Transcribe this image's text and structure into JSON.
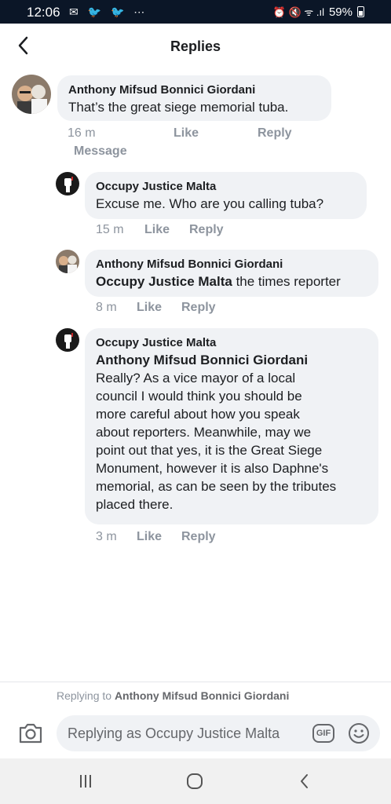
{
  "status_bar": {
    "time": "12:06",
    "notification_icons": "✉ 🐦 🐦 ⋯",
    "system_icons": "⏰ 🔇 ᯤ .ıl",
    "battery": "59%"
  },
  "header": {
    "title": "Replies"
  },
  "comments": [
    {
      "author": "Anthony Mifsud Bonnici Giordani",
      "text": "That’s the great siege memorial tuba.",
      "time": "16 m",
      "like": "Like",
      "reply": "Reply",
      "message": "Message"
    },
    {
      "author": "Occupy Justice Malta",
      "text": "Excuse me.  Who are you calling tuba?",
      "time": "15 m",
      "like": "Like",
      "reply": "Reply"
    },
    {
      "author": "Anthony Mifsud Bonnici Giordani",
      "tag": "Occupy Justice Malta",
      "text": " the times reporter",
      "time": "8 m",
      "like": "Like",
      "reply": "Reply"
    },
    {
      "author": "Occupy Justice Malta",
      "tag": "Anthony Mifsud Bonnici Giordani",
      "text_lines": [
        "Really?  As a vice mayor of a local",
        "council I would think you should be",
        "more careful about how you speak",
        "about reporters.  Meanwhile, may we",
        "point out that yes, it is the Great Siege",
        "Monument, however it is also Daphne's",
        "memorial, as can be seen by the tributes",
        "placed there."
      ],
      "time": "3 m",
      "like": "Like",
      "reply": "Reply"
    }
  ],
  "composer": {
    "replying_prefix": "Replying to ",
    "replying_name": "Anthony Mifsud Bonnici Giordani",
    "placeholder": "Replying as Occupy Justice Malta",
    "gif_label": "GIF"
  },
  "colors": {
    "bubble": "#f0f2f5",
    "meta": "#8d949e",
    "status_bar": "#0b1627"
  }
}
